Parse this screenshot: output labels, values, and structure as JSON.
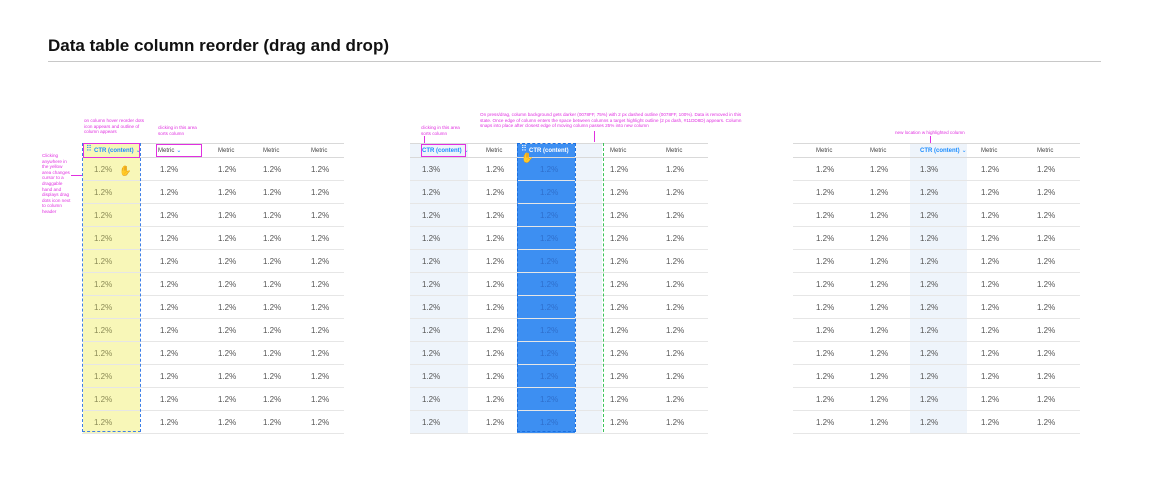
{
  "page": {
    "title": "Data table column reorder (drag and drop)"
  },
  "colors": {
    "accent_blue": "#1a8cff",
    "drag_blue": "#3d8ff2",
    "annotation_pink": "#e030e0",
    "highlight_yellow": "#f8f7b8",
    "target_green": "#3ec45a"
  },
  "panel1": {
    "headers": [
      "CTR (content)",
      "Metric",
      "Metric",
      "Metric",
      "Metric"
    ],
    "first_value": "1.2%",
    "rows": [
      [
        "1.2%",
        "1.2%",
        "1.2%",
        "1.2%",
        "1.2%"
      ],
      [
        "1.2%",
        "1.2%",
        "1.2%",
        "1.2%",
        "1.2%"
      ],
      [
        "1.2%",
        "1.2%",
        "1.2%",
        "1.2%",
        "1.2%"
      ],
      [
        "1.2%",
        "1.2%",
        "1.2%",
        "1.2%",
        "1.2%"
      ],
      [
        "1.2%",
        "1.2%",
        "1.2%",
        "1.2%",
        "1.2%"
      ],
      [
        "1.2%",
        "1.2%",
        "1.2%",
        "1.2%",
        "1.2%"
      ],
      [
        "1.2%",
        "1.2%",
        "1.2%",
        "1.2%",
        "1.2%"
      ],
      [
        "1.2%",
        "1.2%",
        "1.2%",
        "1.2%",
        "1.2%"
      ],
      [
        "1.2%",
        "1.2%",
        "1.2%",
        "1.2%",
        "1.2%"
      ],
      [
        "1.2%",
        "1.2%",
        "1.2%",
        "1.2%",
        "1.2%"
      ],
      [
        "1.2%",
        "1.2%",
        "1.2%",
        "1.2%",
        "1.2%"
      ],
      [
        "1.2%",
        "1.2%",
        "1.2%",
        "1.2%",
        "1.2%"
      ]
    ],
    "note_hover": "on column hover reorder dots icon appears and outline of column appears",
    "note_sort": "clicking in this area sorts column",
    "note_side": "Clicking anywhere in the yellow area changes cursor to a draggable hand and displays drag dots icon next to column header"
  },
  "panel2": {
    "headers": [
      "CTR (content)",
      "Metric",
      "CTR (content)",
      "Metric",
      "Metric"
    ],
    "rows": [
      [
        "1.3%",
        "1.2%",
        "1.2%",
        "1.2%",
        "1.2%"
      ],
      [
        "1.2%",
        "1.2%",
        "1.2%",
        "1.2%",
        "1.2%"
      ],
      [
        "1.2%",
        "1.2%",
        "1.2%",
        "1.2%",
        "1.2%"
      ],
      [
        "1.2%",
        "1.2%",
        "1.2%",
        "1.2%",
        "1.2%"
      ],
      [
        "1.2%",
        "1.2%",
        "1.2%",
        "1.2%",
        "1.2%"
      ],
      [
        "1.2%",
        "1.2%",
        "1.2%",
        "1.2%",
        "1.2%"
      ],
      [
        "1.2%",
        "1.2%",
        "1.2%",
        "1.2%",
        "1.2%"
      ],
      [
        "1.2%",
        "1.2%",
        "1.2%",
        "1.2%",
        "1.2%"
      ],
      [
        "1.2%",
        "1.2%",
        "1.2%",
        "1.2%",
        "1.2%"
      ],
      [
        "1.2%",
        "1.2%",
        "1.2%",
        "1.2%",
        "1.2%"
      ],
      [
        "1.2%",
        "1.2%",
        "1.2%",
        "1.2%",
        "1.2%"
      ],
      [
        "1.2%",
        "1.2%",
        "1.2%",
        "1.2%",
        "1.2%"
      ]
    ],
    "note_sort": "clicking in this area sorts column",
    "note_drag": "On press/drag, column background gets darker (0078FF, 75%) with 2 px dashed outline (0078FF, 100%). Data is removed in this state. Once edge of column enters the space between columns a target highlight outline (2 px dash, #11DD8D) appears. Column snaps into place after closest edge of moving column passes 25% into new column"
  },
  "panel3": {
    "headers": [
      "Metric",
      "Metric",
      "CTR (content)",
      "Metric",
      "Metric"
    ],
    "rows": [
      [
        "1.2%",
        "1.2%",
        "1.3%",
        "1.2%",
        "1.2%"
      ],
      [
        "1.2%",
        "1.2%",
        "1.2%",
        "1.2%",
        "1.2%"
      ],
      [
        "1.2%",
        "1.2%",
        "1.2%",
        "1.2%",
        "1.2%"
      ],
      [
        "1.2%",
        "1.2%",
        "1.2%",
        "1.2%",
        "1.2%"
      ],
      [
        "1.2%",
        "1.2%",
        "1.2%",
        "1.2%",
        "1.2%"
      ],
      [
        "1.2%",
        "1.2%",
        "1.2%",
        "1.2%",
        "1.2%"
      ],
      [
        "1.2%",
        "1.2%",
        "1.2%",
        "1.2%",
        "1.2%"
      ],
      [
        "1.2%",
        "1.2%",
        "1.2%",
        "1.2%",
        "1.2%"
      ],
      [
        "1.2%",
        "1.2%",
        "1.2%",
        "1.2%",
        "1.2%"
      ],
      [
        "1.2%",
        "1.2%",
        "1.2%",
        "1.2%",
        "1.2%"
      ],
      [
        "1.2%",
        "1.2%",
        "1.2%",
        "1.2%",
        "1.2%"
      ],
      [
        "1.2%",
        "1.2%",
        "1.2%",
        "1.2%",
        "1.2%"
      ]
    ],
    "note_location": "new location w highlighted column"
  },
  "icons": {
    "chevron": "chevron-down-icon",
    "grip": "drag-dots-icon",
    "hand": "hand-cursor-icon"
  },
  "glyphs": {
    "chevron": "⌄",
    "grip": "⠿",
    "hand": "✋"
  }
}
